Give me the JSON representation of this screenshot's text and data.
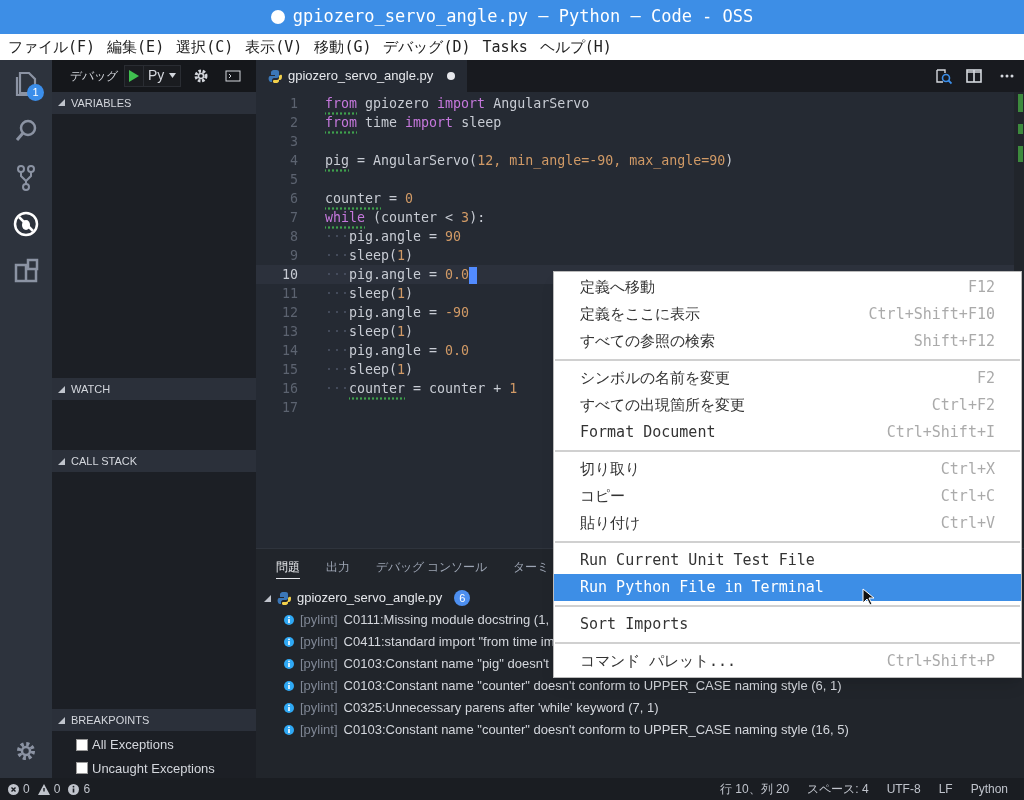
{
  "window": {
    "title": "gpiozero_servo_angle.py — Python — Code - OSS",
    "modified": true
  },
  "menu_bar": [
    "ファイル(F)",
    "編集(E)",
    "選択(C)",
    "表示(V)",
    "移動(G)",
    "デバッグ(D)",
    "Tasks",
    "ヘルプ(H)"
  ],
  "activity_bar": [
    {
      "kind": "files",
      "badge": "1",
      "selected": false
    },
    {
      "kind": "search",
      "selected": false
    },
    {
      "kind": "source-control",
      "selected": false
    },
    {
      "kind": "debug",
      "selected": true
    },
    {
      "kind": "extensions",
      "selected": false
    }
  ],
  "debug_toolbar": {
    "label": "デバッグ",
    "configuration": "Py"
  },
  "sidebar": {
    "sections": [
      {
        "title": "VARIABLES"
      },
      {
        "title": "WATCH"
      },
      {
        "title": "CALL STACK"
      },
      {
        "title": "BREAKPOINTS",
        "items": [
          {
            "label": "All Exceptions",
            "checked": false
          },
          {
            "label": "Uncaught Exceptions",
            "checked": false
          }
        ]
      }
    ]
  },
  "editor": {
    "tab": {
      "title": "gpiozero_servo_angle.py",
      "modified": true
    },
    "lines": [
      {
        "number": "1",
        "current": false,
        "tokens": [
          {
            "text": "from",
            "kind": "keyword",
            "lint": true
          },
          {
            "text": " gpiozero ",
            "kind": "plain",
            "lint": false
          },
          {
            "text": "import",
            "kind": "keyword",
            "lint": false
          },
          {
            "text": " AngularServo",
            "kind": "plain",
            "lint": false
          }
        ]
      },
      {
        "number": "2",
        "current": false,
        "tokens": [
          {
            "text": "from",
            "kind": "keyword",
            "lint": true
          },
          {
            "text": " time ",
            "kind": "plain",
            "lint": false
          },
          {
            "text": "import",
            "kind": "keyword",
            "lint": false
          },
          {
            "text": " sleep",
            "kind": "plain",
            "lint": false
          }
        ]
      },
      {
        "number": "3",
        "current": false
      },
      {
        "number": "4",
        "current": false,
        "tokens": [
          {
            "text": "pig",
            "kind": "plain",
            "lint": true
          },
          {
            "text": " = AngularServo(",
            "kind": "plain",
            "lint": false
          },
          {
            "text": "12",
            "kind": "number",
            "lint": false
          },
          {
            "text": ", min_angle=",
            "kind": "param",
            "lint": false
          },
          {
            "text": "-90",
            "kind": "number",
            "lint": false
          },
          {
            "text": ", max_angle=",
            "kind": "param",
            "lint": false
          },
          {
            "text": "90",
            "kind": "number",
            "lint": false
          },
          {
            "text": ")",
            "kind": "plain",
            "lint": false
          }
        ]
      },
      {
        "number": "5",
        "current": false
      },
      {
        "number": "6",
        "current": false,
        "tokens": [
          {
            "text": "counter",
            "kind": "plain",
            "lint": true
          },
          {
            "text": " = ",
            "kind": "plain",
            "lint": false
          },
          {
            "text": "0",
            "kind": "number",
            "lint": false
          }
        ]
      },
      {
        "number": "7",
        "current": false,
        "tokens": [
          {
            "text": "while",
            "kind": "keyword",
            "lint": true
          },
          {
            "text": " (counter < ",
            "kind": "plain",
            "lint": false
          },
          {
            "text": "3",
            "kind": "number",
            "lint": false
          },
          {
            "text": "):",
            "kind": "plain",
            "lint": false
          }
        ]
      },
      {
        "number": "8",
        "current": false,
        "tokens": [
          {
            "text": "···",
            "kind": "whitespace",
            "lint": false
          },
          {
            "text": "pig.angle = ",
            "kind": "plain",
            "lint": false
          },
          {
            "text": "90",
            "kind": "number",
            "lint": false
          }
        ]
      },
      {
        "number": "9",
        "current": false,
        "tokens": [
          {
            "text": "···",
            "kind": "whitespace",
            "lint": false
          },
          {
            "text": "sleep(",
            "kind": "plain",
            "lint": false
          },
          {
            "text": "1",
            "kind": "number",
            "lint": false
          },
          {
            "text": ")",
            "kind": "plain",
            "lint": false
          }
        ]
      },
      {
        "number": "10",
        "current": true,
        "tokens": [
          {
            "text": "···",
            "kind": "whitespace",
            "lint": false
          },
          {
            "text": "pig.angle = ",
            "kind": "plain",
            "lint": false
          },
          {
            "text": "0.0",
            "kind": "number",
            "lint": false
          }
        ]
      },
      {
        "number": "11",
        "current": false,
        "tokens": [
          {
            "text": "···",
            "kind": "whitespace",
            "lint": false
          },
          {
            "text": "sleep(",
            "kind": "plain",
            "lint": false
          },
          {
            "text": "1",
            "kind": "number",
            "lint": false
          },
          {
            "text": ")",
            "kind": "plain",
            "lint": false
          }
        ]
      },
      {
        "number": "12",
        "current": false,
        "tokens": [
          {
            "text": "···",
            "kind": "whitespace",
            "lint": false
          },
          {
            "text": "pig.angle = ",
            "kind": "plain",
            "lint": false
          },
          {
            "text": "-90",
            "kind": "number",
            "lint": false
          }
        ]
      },
      {
        "number": "13",
        "current": false,
        "tokens": [
          {
            "text": "···",
            "kind": "whitespace",
            "lint": false
          },
          {
            "text": "sleep(",
            "kind": "plain",
            "lint": false
          },
          {
            "text": "1",
            "kind": "number",
            "lint": false
          },
          {
            "text": ")",
            "kind": "plain",
            "lint": false
          }
        ]
      },
      {
        "number": "14",
        "current": false,
        "tokens": [
          {
            "text": "···",
            "kind": "whitespace",
            "lint": false
          },
          {
            "text": "pig.angle = ",
            "kind": "plain",
            "lint": false
          },
          {
            "text": "0.0",
            "kind": "number",
            "lint": false
          }
        ]
      },
      {
        "number": "15",
        "current": false,
        "tokens": [
          {
            "text": "···",
            "kind": "whitespace",
            "lint": false
          },
          {
            "text": "sleep(",
            "kind": "plain",
            "lint": false
          },
          {
            "text": "1",
            "kind": "number",
            "lint": false
          },
          {
            "text": ")",
            "kind": "plain",
            "lint": false
          }
        ]
      },
      {
        "number": "16",
        "current": false,
        "tokens": [
          {
            "text": "···",
            "kind": "whitespace",
            "lint": false
          },
          {
            "text": "counter",
            "kind": "plain",
            "lint": true
          },
          {
            "text": " = counter + ",
            "kind": "plain",
            "lint": false
          },
          {
            "text": "1",
            "kind": "number",
            "lint": false
          }
        ]
      },
      {
        "number": "17",
        "current": false
      }
    ]
  },
  "panel": {
    "tabs": [
      {
        "label": "問題",
        "selected": true
      },
      {
        "label": "出力",
        "selected": false
      },
      {
        "label": "デバッグ コンソール",
        "selected": false
      },
      {
        "label": "ターミ",
        "selected": false
      }
    ],
    "problems": {
      "file": "gpiozero_servo_angle.py",
      "count": "6",
      "items": [
        {
          "source": "[pylint]",
          "message": "C0111:Missing module docstring (1,"
        },
        {
          "source": "[pylint]",
          "message": "C0411:standard import \"from time im"
        },
        {
          "source": "[pylint]",
          "message": "C0103:Constant name \"pig\" doesn't"
        },
        {
          "source": "[pylint]",
          "message": "C0103:Constant name \"counter\" doesn't conform to UPPER_CASE naming style (6, 1)"
        },
        {
          "source": "[pylint]",
          "message": "C0325:Unnecessary parens after 'while' keyword (7, 1)"
        },
        {
          "source": "[pylint]",
          "message": "C0103:Constant name \"counter\" doesn't conform to UPPER_CASE naming style (16, 5)"
        }
      ]
    }
  },
  "context_menu": {
    "items": [
      {
        "kind": "item",
        "label": "定義へ移動",
        "shortcut": "F12",
        "selected": false
      },
      {
        "kind": "item",
        "label": "定義をここに表示",
        "shortcut": "Ctrl+Shift+F10",
        "selected": false
      },
      {
        "kind": "item",
        "label": "すべての参照の検索",
        "shortcut": "Shift+F12",
        "selected": false
      },
      {
        "kind": "separator"
      },
      {
        "kind": "item",
        "label": "シンボルの名前を変更",
        "shortcut": "F2",
        "selected": false
      },
      {
        "kind": "item",
        "label": "すべての出現箇所を変更",
        "shortcut": "Ctrl+F2",
        "selected": false
      },
      {
        "kind": "item",
        "label": "Format Document",
        "shortcut": "Ctrl+Shift+I",
        "selected": false
      },
      {
        "kind": "separator"
      },
      {
        "kind": "item",
        "label": "切り取り",
        "shortcut": "Ctrl+X",
        "selected": false
      },
      {
        "kind": "item",
        "label": "コピー",
        "shortcut": "Ctrl+C",
        "selected": false
      },
      {
        "kind": "item",
        "label": "貼り付け",
        "shortcut": "Ctrl+V",
        "selected": false
      },
      {
        "kind": "separator"
      },
      {
        "kind": "item",
        "label": "Run Current Unit Test File",
        "selected": false
      },
      {
        "kind": "item",
        "label": "Run Python File in Terminal",
        "selected": true
      },
      {
        "kind": "separator"
      },
      {
        "kind": "item",
        "label": "Sort Imports",
        "selected": false
      },
      {
        "kind": "separator"
      },
      {
        "kind": "item",
        "label": "コマンド パレット...",
        "shortcut": "Ctrl+Shift+P",
        "selected": false
      }
    ]
  },
  "status_bar": {
    "errors": "0",
    "warnings": "0",
    "infos": "6",
    "items": [
      "行 10、列 20",
      "スペース: 4",
      "UTF-8",
      "LF",
      "Python"
    ]
  }
}
